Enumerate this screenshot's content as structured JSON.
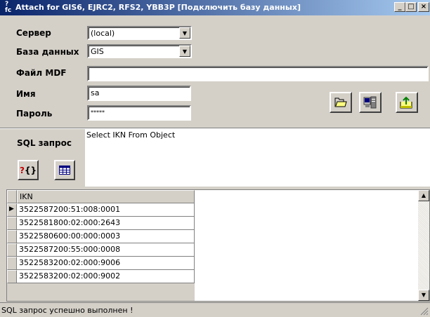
{
  "window": {
    "title": "Attach for GIS6, EJRC2, RFS2, YBB3P  [Подключить базу данных]",
    "app_icon_text": "?fc",
    "minimize": "_",
    "maximize": "□",
    "close": "×"
  },
  "form": {
    "server_label": "Сервер",
    "server_value": "(local)",
    "database_label": "База данных",
    "database_value": "GIS",
    "mdf_label": "Файл MDF",
    "mdf_value": "",
    "name_label": "Имя",
    "name_value": "sa",
    "password_label": "Пароль",
    "password_value": "*****"
  },
  "toolbar": {
    "open_icon": "folder-open-icon",
    "connect_icon": "database-server-icon",
    "export_icon": "export-icon"
  },
  "sql": {
    "label": "SQL запрос",
    "query": "Select IKN From Object",
    "run_icon": "query-icon",
    "grid_icon": "table-icon"
  },
  "grid": {
    "column": "IKN",
    "rows": [
      "3522587200:51:008:0001",
      "3522581800:02:000:2643",
      "3522580600:00:000:0003",
      "3522587200:55:000:0008",
      "3522583200:02:000:9006",
      "3522583200:02:000:9002"
    ]
  },
  "status": {
    "text": "SQL запрос успешно выполнен !"
  }
}
